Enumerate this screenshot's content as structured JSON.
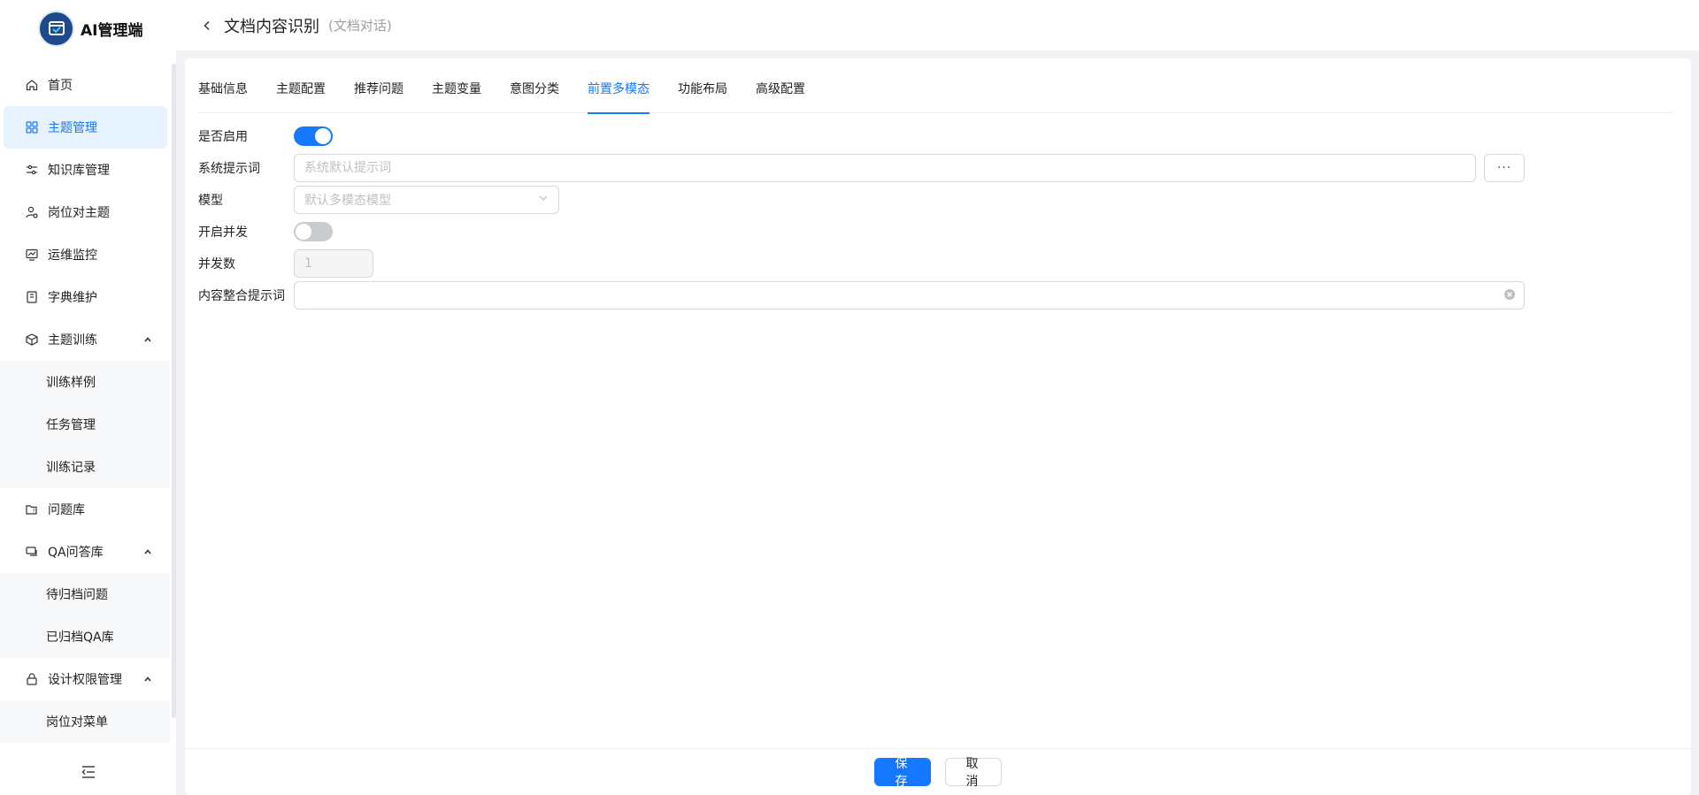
{
  "app": {
    "name": "AI管理端"
  },
  "header": {
    "title": "文档内容识别",
    "subtitle": "(文档对话)"
  },
  "sidebar": {
    "items": [
      {
        "label": "首页",
        "icon": "home-icon"
      },
      {
        "label": "主题管理",
        "icon": "grid-icon",
        "active": true
      },
      {
        "label": "知识库管理",
        "icon": "sliders-icon"
      },
      {
        "label": "岗位对主题",
        "icon": "user-icon"
      },
      {
        "label": "运维监控",
        "icon": "monitor-chart-icon"
      },
      {
        "label": "字典维护",
        "icon": "book-icon"
      },
      {
        "label": "主题训练",
        "icon": "cube-icon",
        "expanded": true,
        "children": [
          {
            "label": "训练样例"
          },
          {
            "label": "任务管理"
          },
          {
            "label": "训练记录"
          }
        ]
      },
      {
        "label": "问题库",
        "icon": "folder-question-icon"
      },
      {
        "label": "QA问答库",
        "icon": "chat-icon",
        "expanded": true,
        "children": [
          {
            "label": "待归档问题"
          },
          {
            "label": "已归档QA库"
          }
        ]
      },
      {
        "label": "设计权限管理",
        "icon": "lock-icon",
        "expanded": true,
        "children": [
          {
            "label": "岗位对菜单"
          }
        ]
      }
    ]
  },
  "tabs": [
    {
      "label": "基础信息"
    },
    {
      "label": "主题配置"
    },
    {
      "label": "推荐问题"
    },
    {
      "label": "主题变量"
    },
    {
      "label": "意图分类"
    },
    {
      "label": "前置多模态",
      "active": true
    },
    {
      "label": "功能布局"
    },
    {
      "label": "高级配置"
    }
  ],
  "form": {
    "enabled": {
      "label": "是否启用",
      "value": true
    },
    "system_prompt": {
      "label": "系统提示词",
      "placeholder": "系统默认提示词",
      "value": "",
      "more_label": "···"
    },
    "model": {
      "label": "模型",
      "placeholder": "默认多模态模型"
    },
    "concurrency_enabled": {
      "label": "开启并发",
      "value": false
    },
    "concurrency": {
      "label": "并发数",
      "value": "1"
    },
    "merge_prompt": {
      "label": "内容整合提示词",
      "value": ""
    }
  },
  "actions": {
    "save_label": "保 存",
    "cancel_label": "取 消"
  },
  "colors": {
    "primary": "#1677ff",
    "active_bg": "#e6f3ff",
    "logo_bg": "#1d4a8a"
  }
}
